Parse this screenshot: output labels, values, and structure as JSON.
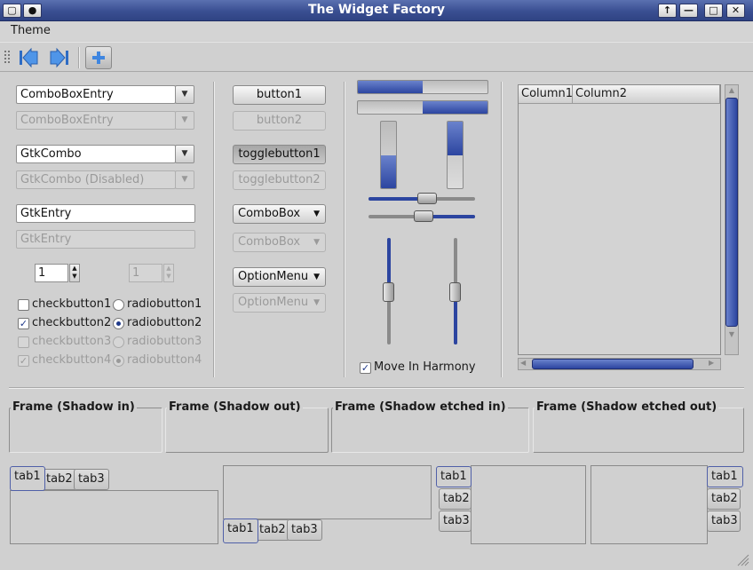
{
  "window": {
    "title": "The Widget Factory",
    "controls": [
      "↑",
      "—",
      "□",
      "✕"
    ]
  },
  "menu": {
    "items": [
      "Theme"
    ]
  },
  "toolbar": {
    "icons": [
      "go-first-icon",
      "go-last-icon",
      "add-icon"
    ]
  },
  "left": {
    "combo_entry": "ComboBoxEntry",
    "combo_entry_disabled": "ComboBoxEntry",
    "gtk_combo": "GtkCombo",
    "gtk_combo_disabled": "GtkCombo (Disabled)",
    "entry": "GtkEntry",
    "entry_disabled": "GtkEntry",
    "spin": "1",
    "spin_disabled": "1",
    "checks": [
      {
        "label": "checkbutton1",
        "checked": false,
        "disabled": false
      },
      {
        "label": "checkbutton2",
        "checked": true,
        "disabled": false
      },
      {
        "label": "checkbutton3",
        "checked": false,
        "disabled": true
      },
      {
        "label": "checkbutton4",
        "checked": true,
        "disabled": true
      }
    ],
    "radios": [
      {
        "label": "radiobutton1",
        "checked": false,
        "disabled": false
      },
      {
        "label": "radiobutton2",
        "checked": true,
        "disabled": false
      },
      {
        "label": "radiobutton3",
        "checked": false,
        "disabled": true
      },
      {
        "label": "radiobutton4",
        "checked": true,
        "disabled": true
      }
    ]
  },
  "buttons": {
    "button1": "button1",
    "button2": "button2",
    "toggle1": "togglebutton1",
    "toggle2": "togglebutton2",
    "combobox": "ComboBox",
    "combobox_disabled": "ComboBox",
    "optionmenu": "OptionMenu",
    "optionmenu_disabled": "OptionMenu"
  },
  "ranges": {
    "hprogress1": 0.5,
    "hprogress2": 0.5,
    "vprogress1": 0.5,
    "vprogress2": 0.5,
    "hscale1": 0.5,
    "hscale2": 0.5,
    "vscale1": 0.5,
    "vscale2": 0.5,
    "harmony_label": "Move In Harmony"
  },
  "tree": {
    "columns": [
      "Column1",
      "Column2"
    ]
  },
  "frames": [
    "Frame (Shadow in)",
    "Frame (Shadow out)",
    "Frame (Shadow etched in)",
    "Frame (Shadow etched out)"
  ],
  "notebooks": {
    "tabs": [
      "tab1",
      "tab2",
      "tab3"
    ]
  },
  "colors": {
    "accent": "#2c45a0",
    "titlebar": "#3a4f92"
  }
}
